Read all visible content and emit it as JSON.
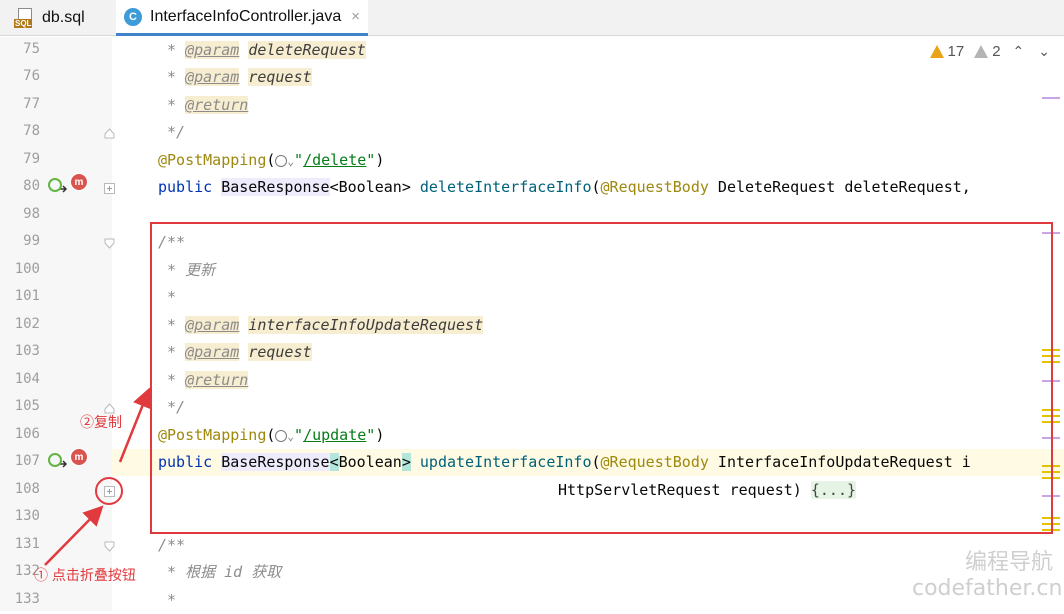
{
  "tabs": [
    {
      "label": "db.sql",
      "icon": "sql-file-icon",
      "active": false
    },
    {
      "label": "InterfaceInfoController.java",
      "icon": "class-c-icon",
      "active": true,
      "close": "×"
    }
  ],
  "inspection": {
    "warnings": "17",
    "weak_warnings": "2"
  },
  "line_numbers": [
    "75",
    "76",
    "77",
    "78",
    "79",
    "80",
    "98",
    "99",
    "100",
    "101",
    "102",
    "103",
    "104",
    "105",
    "106",
    "107",
    "108",
    "130",
    "131",
    "132",
    "133"
  ],
  "code": {
    "l75": {
      "star": " * ",
      "tag": "@param",
      "sp": " ",
      "name": "deleteRequest"
    },
    "l76": {
      "star": " * ",
      "tag": "@param",
      "sp": " ",
      "name": "request"
    },
    "l77": {
      "star": " * ",
      "tag": "@return"
    },
    "l78": {
      "text": " */"
    },
    "l79": {
      "ann": "@PostMapping",
      "open": "(",
      "arrow": "⌄",
      "q1": "\"",
      "path": "/delete",
      "q2": "\"",
      "close": ")"
    },
    "l80": {
      "kw": "public",
      "type": "BaseResponse",
      "generic": "<Boolean>",
      "method": "deleteInterfaceInfo",
      "open": "(",
      "ann": "@RequestBody",
      "rest": " DeleteRequest deleteRequest,"
    },
    "l99": {
      "text": "/**"
    },
    "l100": {
      "text": " * 更新"
    },
    "l101": {
      "text": " *"
    },
    "l102": {
      "star": " * ",
      "tag": "@param",
      "sp": " ",
      "name": "interfaceInfoUpdateRequest"
    },
    "l103": {
      "star": " * ",
      "tag": "@param",
      "sp": " ",
      "name": "request"
    },
    "l104": {
      "star": " * ",
      "tag": "@return"
    },
    "l105": {
      "text": " */"
    },
    "l106": {
      "ann": "@PostMapping",
      "open": "(",
      "arrow": "⌄",
      "q1": "\"",
      "path": "/update",
      "q2": "\"",
      "close": ")"
    },
    "l107": {
      "kw": "public",
      "type": "BaseResponse",
      "lt": "<",
      "generic": "Boolean",
      "gt": ">",
      "method": "updateInterfaceInfo",
      "open": "(",
      "ann": "@RequestBody",
      "rest": " InterfaceInfoUpdateRequest i"
    },
    "l108": {
      "text": "HttpServletRequest request)",
      "fold": "{...}"
    },
    "l131": {
      "text": "/**"
    },
    "l132": {
      "text": " * 根据 id 获取"
    },
    "l133": {
      "text": " *"
    }
  },
  "annotations": {
    "copy": "②复制",
    "fold_button": "① 点击折叠按钮"
  },
  "watermark": {
    "line1": "编程导航",
    "line2": "codefather.cn"
  }
}
